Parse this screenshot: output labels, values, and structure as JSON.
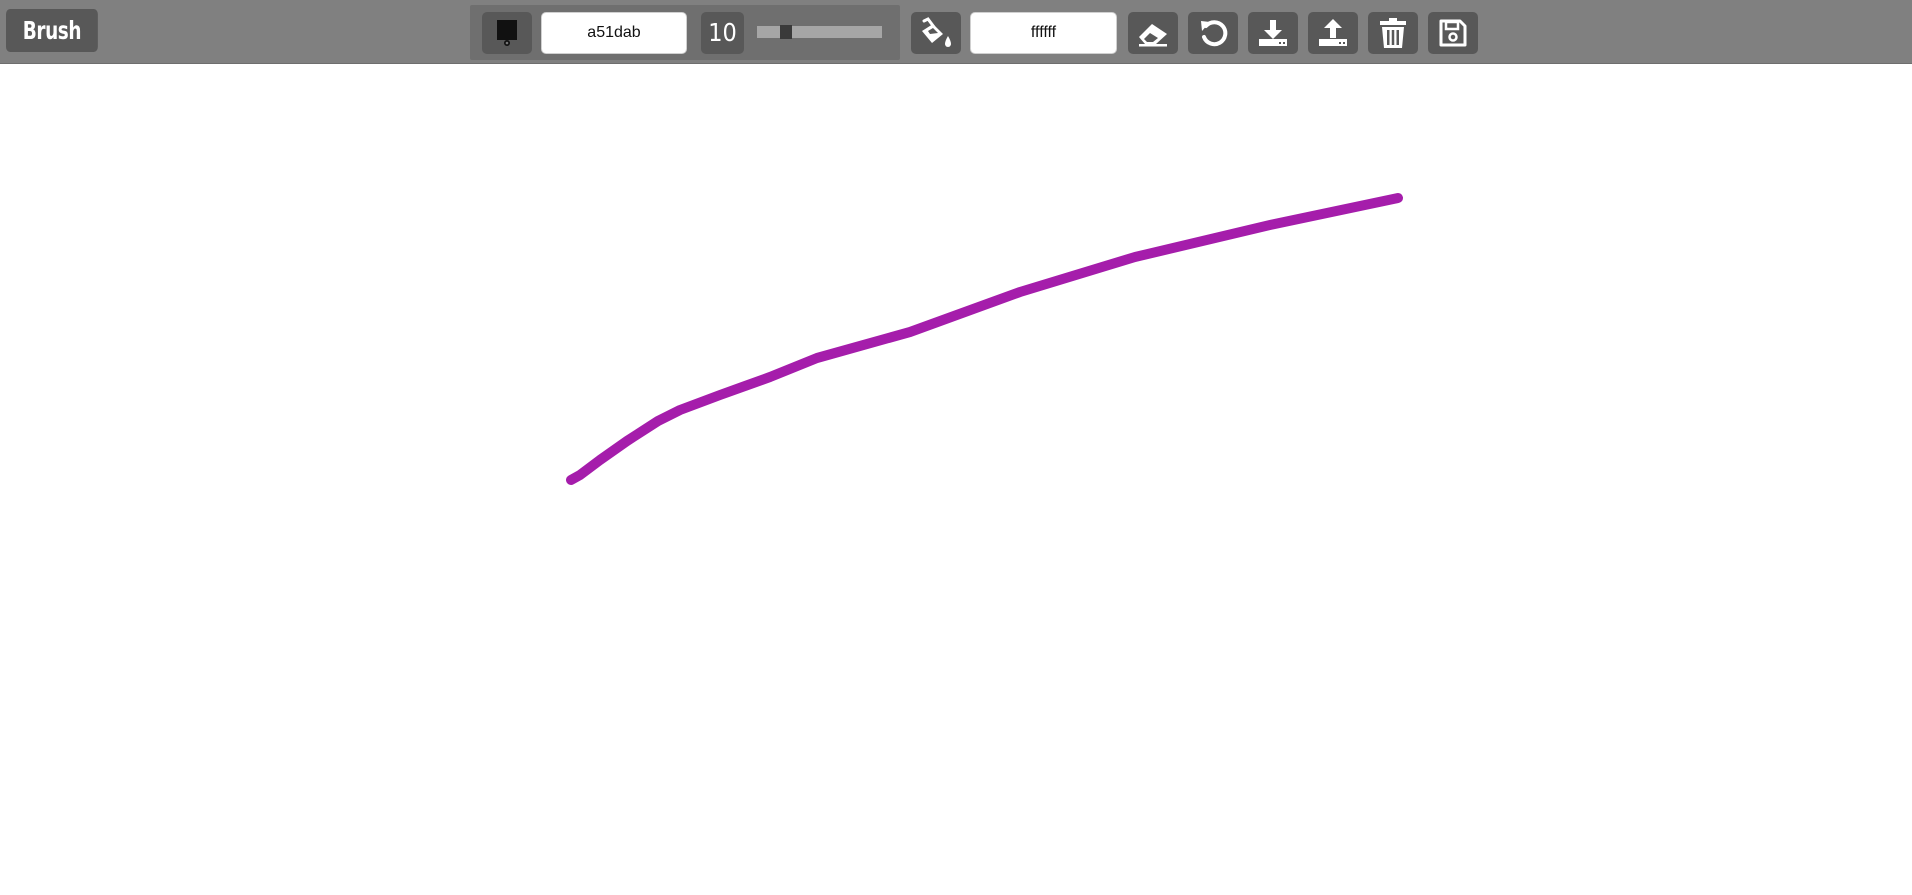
{
  "toolbar": {
    "tool_name": "Brush",
    "brush_icon": "brush-icon",
    "brush_color_hex": "a51dab",
    "brush_size": "10",
    "brush_size_value": 10,
    "brush_size_max": 100,
    "fill_icon": "paint-bucket-icon",
    "background_color_hex": "ffffff",
    "actions": [
      {
        "icon": "eraser-icon"
      },
      {
        "icon": "undo-icon"
      },
      {
        "icon": "download-icon"
      },
      {
        "icon": "upload-icon"
      },
      {
        "icon": "trash-icon"
      },
      {
        "icon": "save-icon"
      }
    ]
  },
  "canvas": {
    "background_color": "#ffffff",
    "stroke_color": "#a51dab"
  }
}
